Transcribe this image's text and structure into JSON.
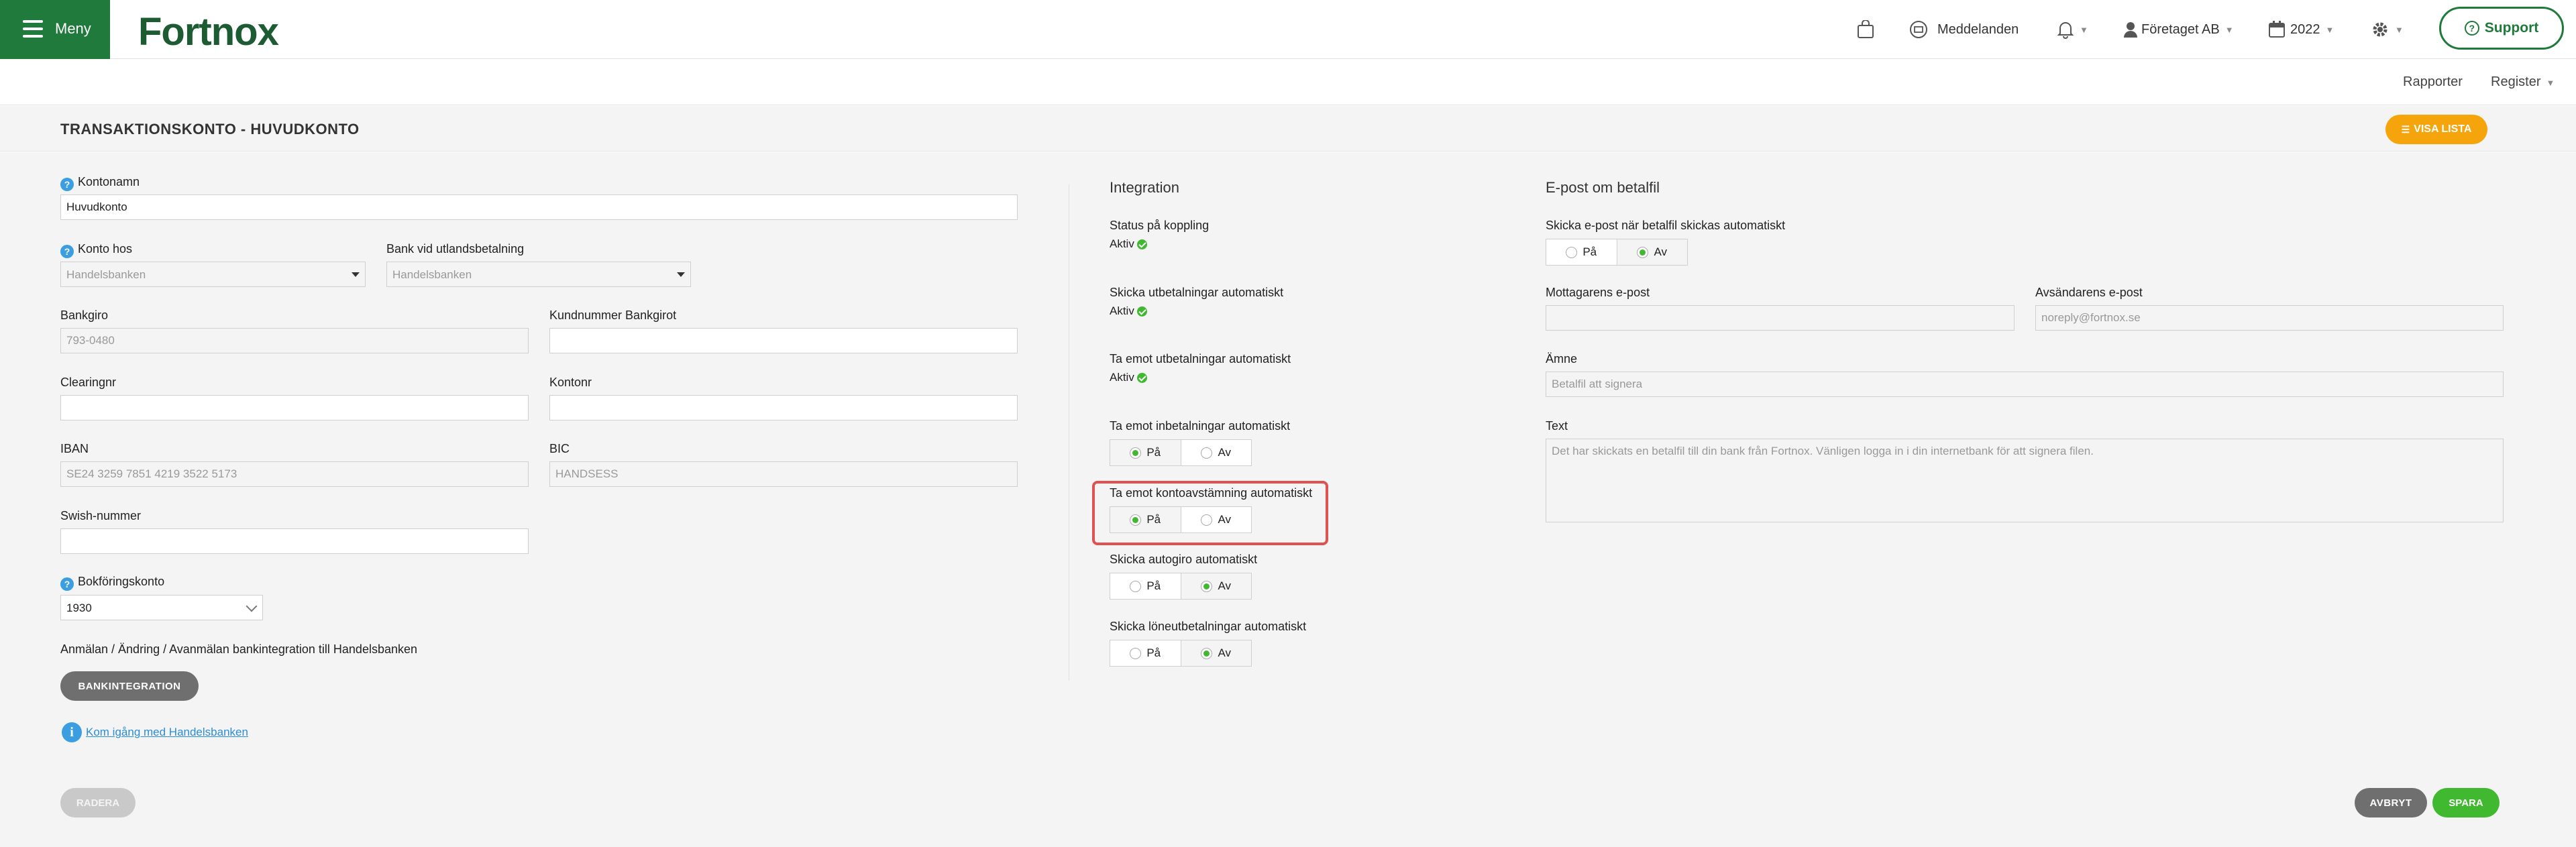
{
  "topbar": {
    "menu_label": "Meny",
    "logo": "Fortnox",
    "messages_label": "Meddelanden",
    "company_label": "Företaget AB",
    "year_label": "2022",
    "support_label": "Support"
  },
  "subnav": {
    "reports": "Rapporter",
    "register": "Register"
  },
  "header": {
    "title": "TRANSAKTIONSKONTO - HUVUDKONTO",
    "visa_lista": "VISA LISTA"
  },
  "form": {
    "kontonamn_label": "Kontonamn",
    "kontonamn_value": "Huvudkonto",
    "konto_hos_label": "Konto hos",
    "konto_hos_value": "Handelsbanken",
    "bank_utland_label": "Bank vid utlandsbetalning",
    "bank_utland_value": "Handelsbanken",
    "bankgiro_label": "Bankgiro",
    "bankgiro_value": "793-0480",
    "kundnummer_label": "Kundnummer Bankgirot",
    "kundnummer_value": "",
    "clearing_label": "Clearingnr",
    "clearing_value": "",
    "kontonr_label": "Kontonr",
    "kontonr_value": "",
    "iban_label": "IBAN",
    "iban_value": "SE24 3259 7851 4219 3522 5173",
    "bic_label": "BIC",
    "bic_value": "HANDSESS",
    "swish_label": "Swish-nummer",
    "swish_value": "",
    "bokforing_label": "Bokföringskonto",
    "bokforing_value": "1930",
    "bankintegration_text": "Anmälan / Ändring / Avanmälan bankintegration till Handelsbanken",
    "bankintegration_button": "BANKINTEGRATION",
    "kom_igang_link": "Kom igång med Handelsbanken",
    "radera_button": "RADERA"
  },
  "integration": {
    "title": "Integration",
    "status_label": "Status på koppling",
    "status_value": "Aktiv",
    "skicka_utbet_label": "Skicka utbetalningar automatiskt",
    "skicka_utbet_value": "Aktiv",
    "ta_emot_utbet_label": "Ta emot utbetalningar automatiskt",
    "ta_emot_utbet_value": "Aktiv",
    "ta_emot_inbet_label": "Ta emot inbetalningar automatiskt",
    "ta_emot_konto_label": "Ta emot kontoavstämning automatiskt",
    "skicka_autogiro_label": "Skicka autogiro automatiskt",
    "skicka_lone_label": "Skicka löneutbetalningar automatiskt",
    "on_label": "På",
    "off_label": "Av"
  },
  "email": {
    "title": "E-post om betalfil",
    "skicka_label": "Skicka e-post när betalfil skickas automatiskt",
    "mottagare_label": "Mottagarens e-post",
    "mottagare_value": "",
    "avsandare_label": "Avsändarens e-post",
    "avsandare_placeholder": "noreply@fortnox.se",
    "amne_label": "Ämne",
    "amne_placeholder": "Betalfil att signera",
    "text_label": "Text",
    "text_placeholder": "Det har skickats en betalfil till din bank från Fortnox. Vänligen logga in i din internetbank för att signera filen."
  },
  "footer": {
    "avbryt": "AVBRYT",
    "spara": "SPARA"
  },
  "colors": {
    "brand_green": "#1f7a3c",
    "save_green": "#40b830",
    "orange": "#f5a50b",
    "highlight_red": "#e05252"
  }
}
